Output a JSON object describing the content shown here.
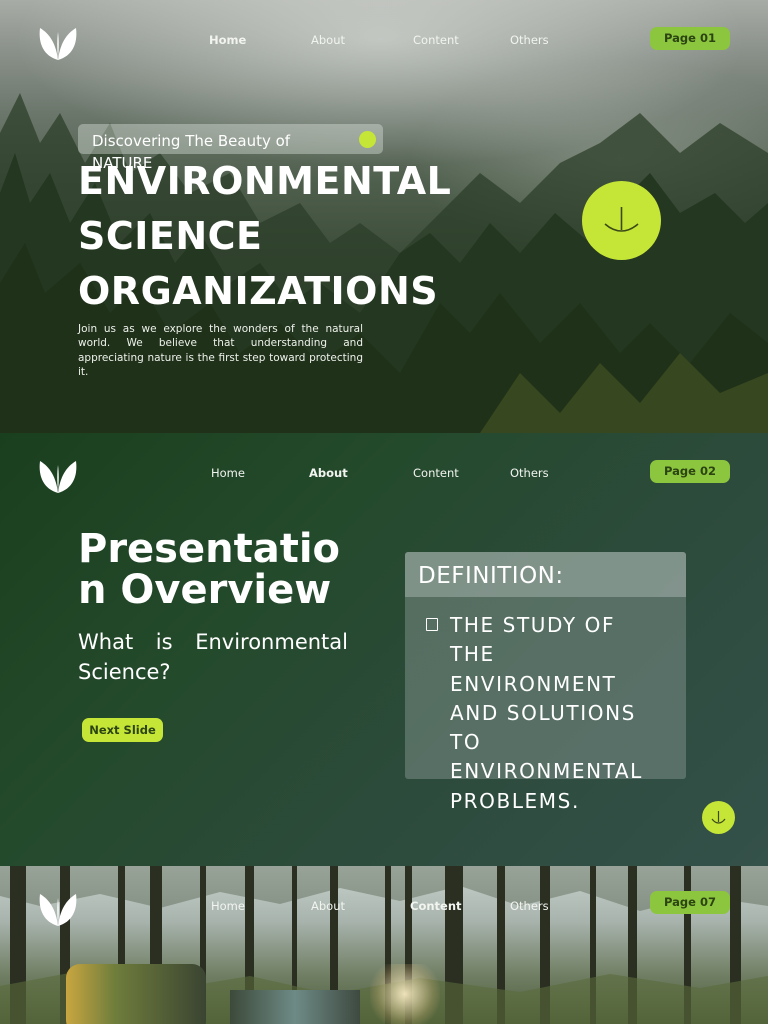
{
  "nav": {
    "items": [
      "Home",
      "About",
      "Content",
      "Others"
    ]
  },
  "section1": {
    "page_label": "Page 01",
    "active_nav": "Home",
    "tagline": "Discovering The Beauty of NATURE",
    "title_lines": [
      "ENVIRONMENTAL",
      "SCIENCE",
      "ORGANIZATIONS"
    ],
    "description": "Join us as we explore the wonders of the natural world. We believe that understanding and appreciating nature is the first step toward protecting it."
  },
  "section2": {
    "page_label": "Page 02",
    "active_nav": "About",
    "title": "Presentation Overview",
    "subtitle": "What is Environmental Science?",
    "next_button": "Next Slide",
    "definition_heading": "DEFINITION:",
    "definition_text": "THE STUDY OF THE ENVIRONMENT AND SOLUTIONS TO ENVIRONMENTAL PROBLEMS."
  },
  "section3": {
    "page_label": "Page 07",
    "active_nav": "Content"
  },
  "colors": {
    "accent_lime": "#c5e637",
    "pill_green": "#8cc63f",
    "overview_bg": "#1a3f1e"
  },
  "icons": {
    "logo": "leaf-logo-icon",
    "scroll": "arrow-down-icon",
    "bullet": "square-bullet-icon"
  }
}
